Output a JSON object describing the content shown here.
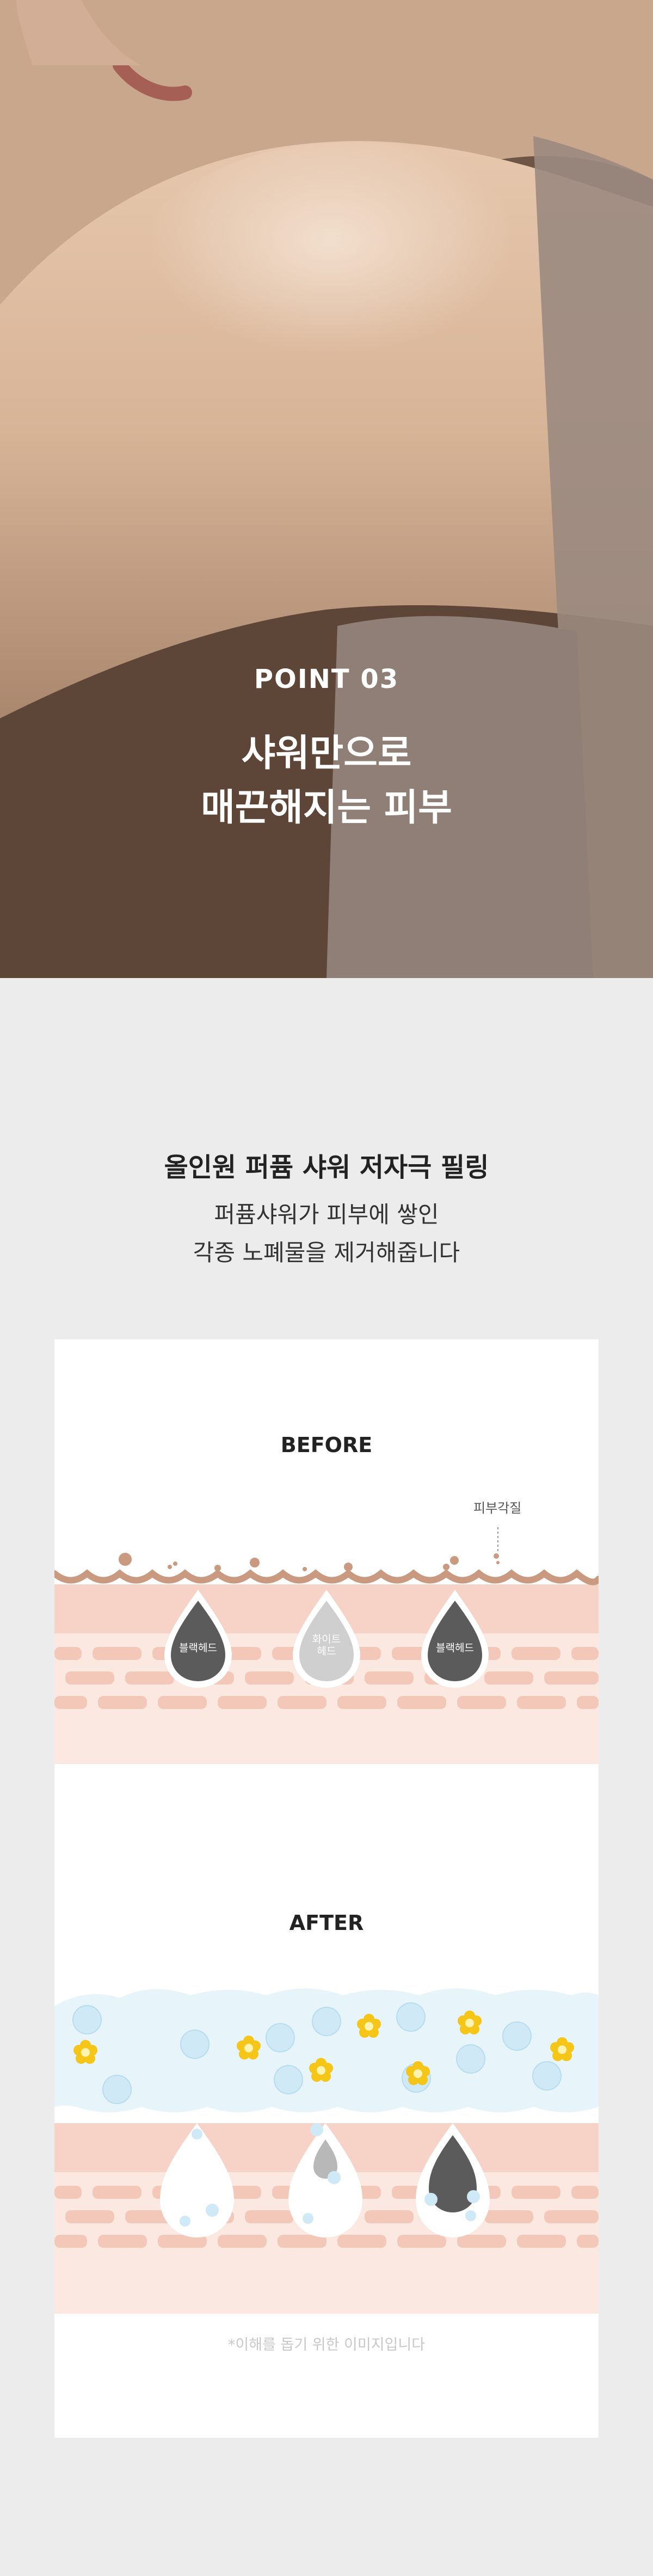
{
  "hero": {
    "point_label": "POINT 03",
    "headline_line1": "샤워만으로",
    "headline_line2": "매끈해지는 피부"
  },
  "section": {
    "title": "올인원 퍼퓸 샤워 저자극 필링",
    "desc_line1": "퍼퓸샤워가 피부에 쌓인",
    "desc_line2": "각종 노폐물을 제거해줍니다"
  },
  "diagram": {
    "before_label": "BEFORE",
    "skin_keratin_label": "피부각질",
    "drop_blackhead_1": "블랙헤드",
    "drop_whitehead_line1": "화이트",
    "drop_whitehead_line2": "헤드",
    "drop_blackhead_2": "블랙헤드",
    "after_label": "AFTER",
    "note": "*이해를 돕기 위한 이미지입니다",
    "colors": {
      "skin_top": "#f6d3c6",
      "skin_bottom": "#fbe9e1",
      "keratin": "#c99a80",
      "blackhead": "#5b5b5b",
      "whitehead": "#cfcfcf",
      "foam": "#e7f5fb",
      "flower": "#f5c518"
    }
  }
}
